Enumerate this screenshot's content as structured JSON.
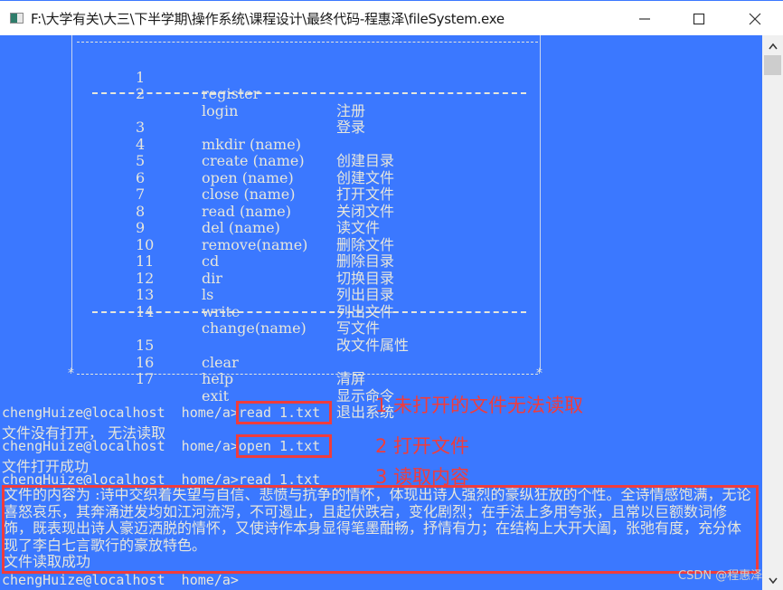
{
  "window": {
    "title": "F:\\大学有关\\大三\\下半学期\\操作系统\\课程设计\\最终代码-程惠泽\\fileSystem.exe",
    "icon": "console-app-icon",
    "controls": [
      "minimize",
      "maximize",
      "close"
    ]
  },
  "menu": {
    "groups": [
      [
        {
          "num": "1",
          "cmd": "register",
          "desc": "注册"
        },
        {
          "num": "2",
          "cmd": "login",
          "desc": "登录"
        }
      ],
      [
        {
          "num": "3",
          "cmd": "mkdir (name)",
          "desc": "创建目录"
        },
        {
          "num": "4",
          "cmd": "create (name)",
          "desc": "创建文件"
        },
        {
          "num": "5",
          "cmd": "open (name)",
          "desc": "打开文件"
        },
        {
          "num": "6",
          "cmd": "close (name)",
          "desc": "关闭文件"
        },
        {
          "num": "7",
          "cmd": "read (name)",
          "desc": "读文件"
        },
        {
          "num": "8",
          "cmd": "del (name)",
          "desc": "删除文件"
        },
        {
          "num": "9",
          "cmd": "remove(name)",
          "desc": "删除目录"
        },
        {
          "num": "10",
          "cmd": "cd",
          "desc": "切换目录"
        },
        {
          "num": "11",
          "cmd": "dir",
          "desc": "列出目录"
        },
        {
          "num": "12",
          "cmd": "ls",
          "desc": "列出文件"
        },
        {
          "num": "13",
          "cmd": "write",
          "desc": "写文件"
        },
        {
          "num": "14",
          "cmd": "change(name)",
          "desc": "改文件属性"
        }
      ],
      [
        {
          "num": "15",
          "cmd": "clear",
          "desc": "清屏"
        },
        {
          "num": "16",
          "cmd": "help",
          "desc": "显示命令"
        },
        {
          "num": "17",
          "cmd": "exit",
          "desc": "退出系统"
        }
      ]
    ]
  },
  "session": {
    "prompt": "chengHuize@localhost  home/a>",
    "lines": [
      {
        "type": "cmd",
        "text": "read 1.txt"
      },
      {
        "type": "out",
        "text": "文件没有打开， 无法读取"
      },
      {
        "type": "cmd",
        "text": "open 1.txt"
      },
      {
        "type": "out",
        "text": "文件打开成功"
      },
      {
        "type": "cmd",
        "text": "read 1.txt"
      }
    ],
    "file_content": "文件的内容为 :诗中交织着失望与自信、悲愤与抗争的情怀，体现出诗人强烈的豪纵狂放的个性。全诗情感饱满，无论喜怒哀乐，其奔涌迸发均如江河流泻，不可遏止，且起伏跌宕，变化剧烈；在手法上多用夸张，且常以巨额数词修饰，既表现出诗人豪迈洒脱的情怀，又使诗作本身显得笔墨酣畅，抒情有力；在结构上大开大阖，张弛有度，充分体现了李白七言歌行的豪放特色。",
    "read_result": "文件读取成功",
    "final_prompt": "chengHuize@localhost  home/a>"
  },
  "annotations": [
    "1 未打开的文件无法读取",
    "2 打开文件",
    "3 读取内容"
  ],
  "watermark": "CSDN @程惠泽",
  "colors": {
    "console_bg": "#3b78ff",
    "console_text": "#e6e6dc",
    "annotation_red": "#f03c3c"
  }
}
